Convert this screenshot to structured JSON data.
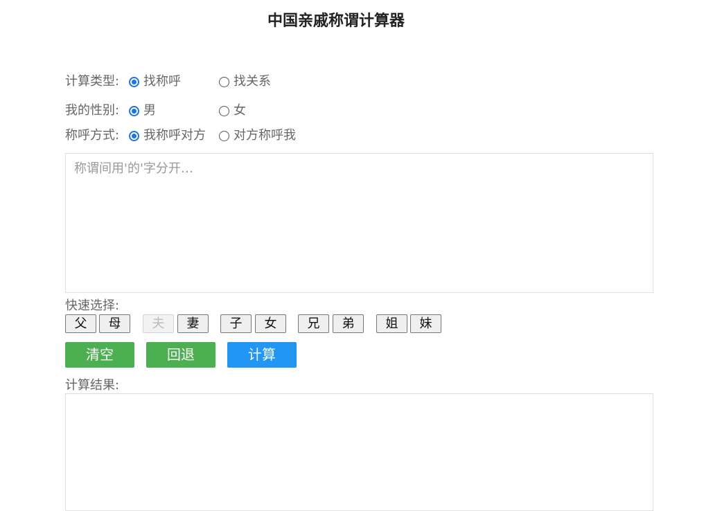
{
  "title": "中国亲戚称谓计算器",
  "form": {
    "calc_type": {
      "label": "计算类型:",
      "options": [
        "找称呼",
        "找关系"
      ],
      "selected": 0
    },
    "gender": {
      "label": "我的性别:",
      "options": [
        "男",
        "女"
      ],
      "selected": 0
    },
    "address_mode": {
      "label": "称呼方式:",
      "options": [
        "我称呼对方",
        "对方称呼我"
      ],
      "selected": 0
    },
    "input": {
      "placeholder": "称谓间用'的'字分开…",
      "value": ""
    }
  },
  "quick": {
    "label": "快速选择:",
    "buttons": [
      {
        "label": "父",
        "disabled": false
      },
      {
        "label": "母",
        "disabled": false
      },
      {
        "label": "夫",
        "disabled": true
      },
      {
        "label": "妻",
        "disabled": false
      },
      {
        "label": "子",
        "disabled": false
      },
      {
        "label": "女",
        "disabled": false
      },
      {
        "label": "兄",
        "disabled": false
      },
      {
        "label": "弟",
        "disabled": false
      },
      {
        "label": "姐",
        "disabled": false
      },
      {
        "label": "妹",
        "disabled": false
      }
    ]
  },
  "actions": {
    "clear_label": "清空",
    "back_label": "回退",
    "calc_label": "计算",
    "clear_color": "#4caf50",
    "back_color": "#4caf50",
    "calc_color": "#2196f3"
  },
  "result": {
    "label": "计算结果:",
    "value": ""
  },
  "colors": {
    "radio_accent": "#1a73e8"
  }
}
